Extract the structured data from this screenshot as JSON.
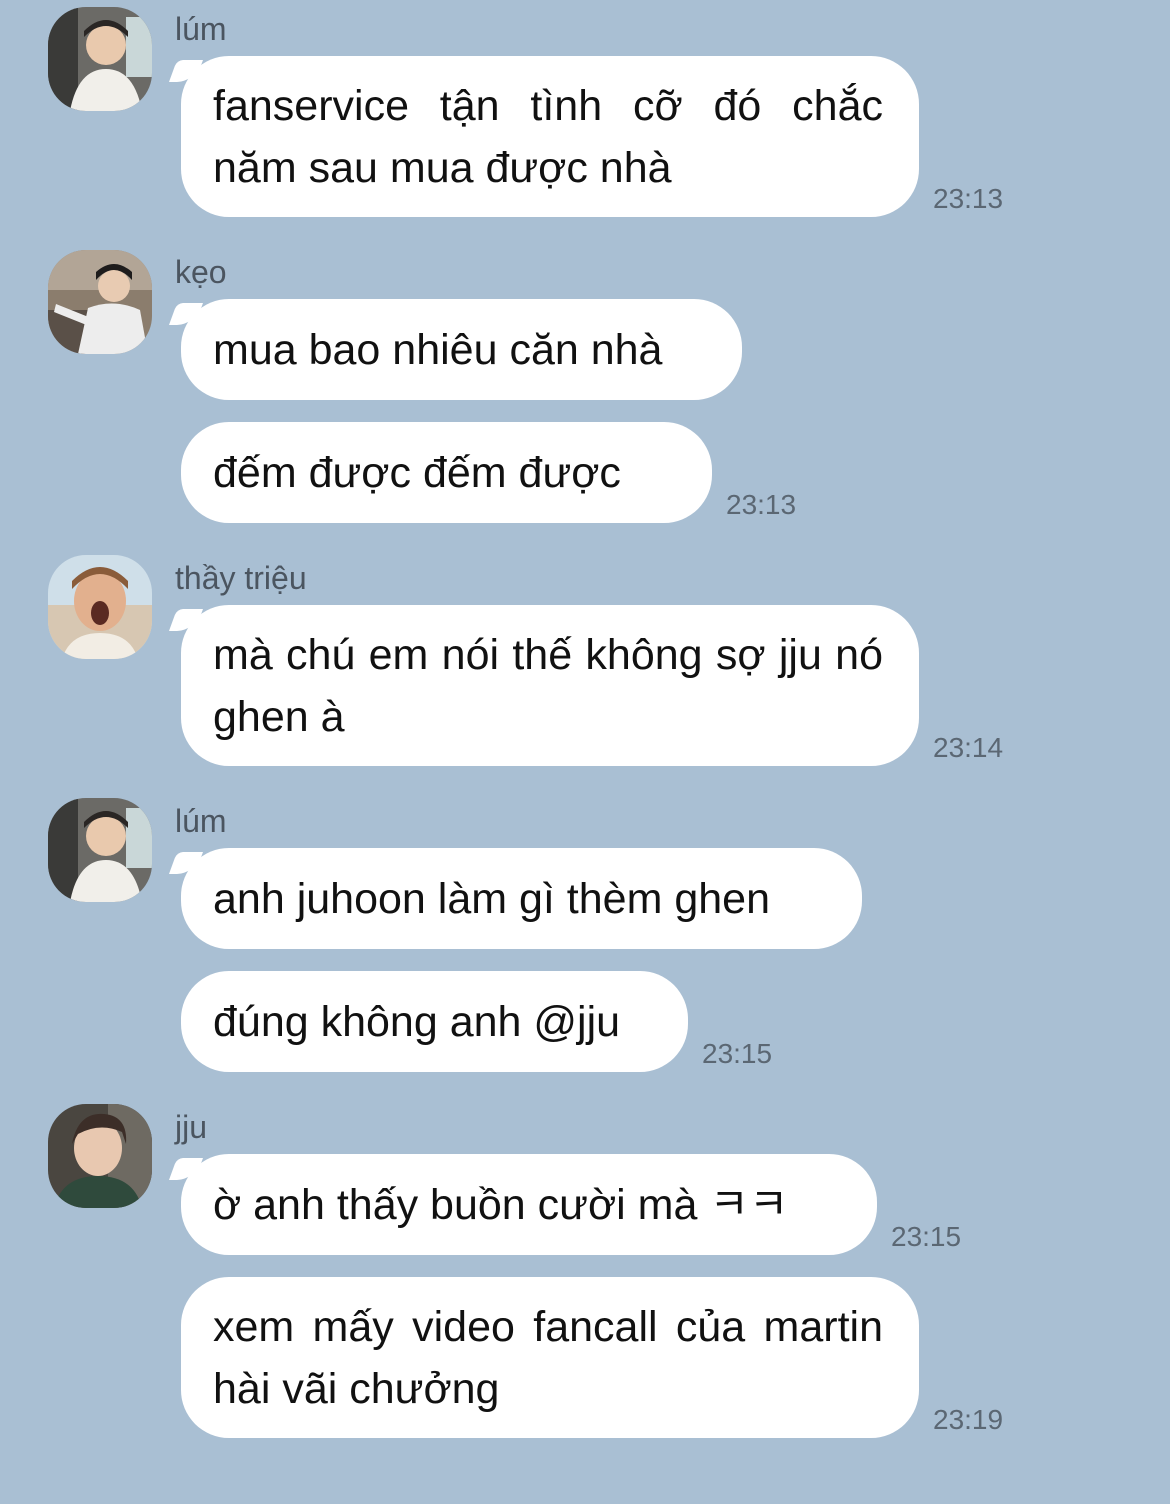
{
  "messages": [
    {
      "sender": "lúm",
      "avatar_icon": "avatar-lum-icon",
      "bubbles": [
        {
          "text": "fanservice tận tình cỡ đó chắc năm sau mua được nhà",
          "time": "23:13"
        }
      ]
    },
    {
      "sender": "kẹo",
      "avatar_icon": "avatar-keo-icon",
      "bubbles": [
        {
          "text": "mua bao nhiêu căn nhà"
        },
        {
          "text": "đếm được đếm được",
          "time": "23:13"
        }
      ]
    },
    {
      "sender": "thầy triệu",
      "avatar_icon": "avatar-thay-trieu-icon",
      "bubbles": [
        {
          "text": "mà chú em nói thế không sợ jju nó ghen à",
          "time": "23:14"
        }
      ]
    },
    {
      "sender": "lúm",
      "avatar_icon": "avatar-lum-icon",
      "bubbles": [
        {
          "text": "anh juhoon làm gì thèm ghen"
        },
        {
          "text": "đúng không anh @jju",
          "time": "23:15"
        }
      ]
    },
    {
      "sender": "jju",
      "avatar_icon": "avatar-jju-icon",
      "bubbles": [
        {
          "text": "ờ anh thấy buồn cười mà ㅋㅋ",
          "time": "23:15"
        },
        {
          "text": "xem mấy video fancall của martin hài vãi chưởng",
          "time": "23:19"
        }
      ]
    }
  ],
  "colors": {
    "background": "#a9bfd3",
    "bubble": "#ffffff",
    "sender_text": "#4b5560",
    "time_text": "#5b6773"
  }
}
